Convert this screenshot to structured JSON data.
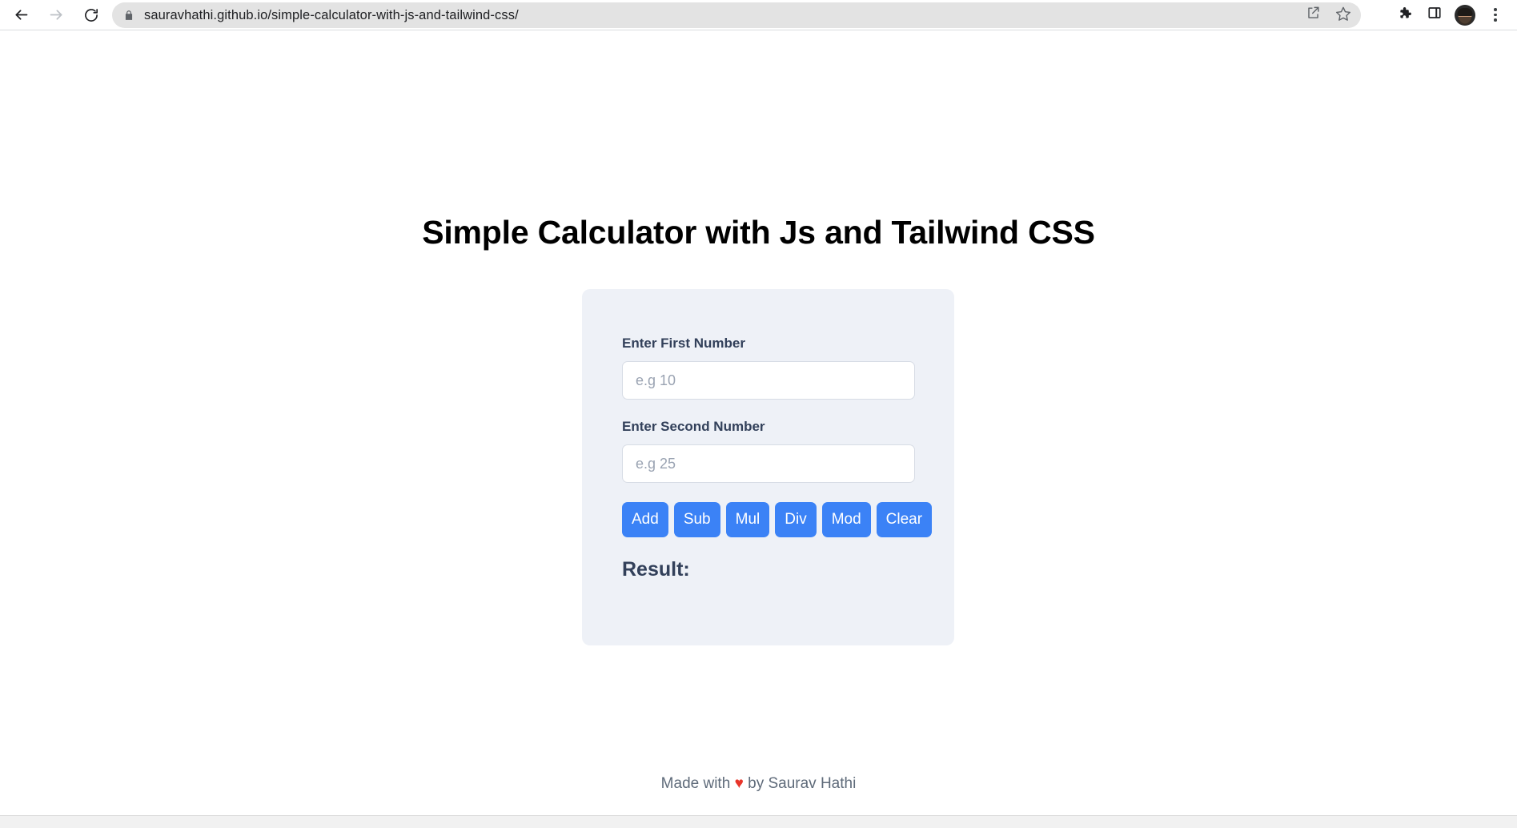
{
  "browser": {
    "back_icon": "back-arrow-icon",
    "forward_icon": "forward-arrow-icon",
    "reload_icon": "reload-icon",
    "lock_icon": "lock-icon",
    "url": "sauravhathi.github.io/simple-calculator-with-js-and-tailwind-css/",
    "share_icon": "share-icon",
    "bookmark_icon": "bookmark-star-icon",
    "extensions_icon": "extensions-puzzle-icon",
    "sidepanel_icon": "side-panel-icon",
    "avatar_icon": "profile-avatar",
    "menu_icon": "three-dot-menu-icon"
  },
  "page": {
    "title": "Simple Calculator with Js and Tailwind CSS",
    "card": {
      "fields": [
        {
          "label": "Enter First Number",
          "placeholder": "e.g 10",
          "value": ""
        },
        {
          "label": "Enter Second Number",
          "placeholder": "e.g 25",
          "value": ""
        }
      ],
      "buttons": [
        {
          "label": "Add"
        },
        {
          "label": "Sub"
        },
        {
          "label": "Mul"
        },
        {
          "label": "Div"
        },
        {
          "label": "Mod"
        },
        {
          "label": "Clear"
        }
      ],
      "result_label": "Result:",
      "result_value": ""
    },
    "footer": {
      "prefix": "Made with",
      "heart": "♥",
      "suffix": "by Saurav Hathi"
    }
  },
  "colors": {
    "accent_blue": "#3b82f6",
    "card_bg": "#eef1f7",
    "text_slate": "#32405a",
    "heart_red": "#e8352a",
    "omnibox_bg": "#e3e3e3"
  }
}
